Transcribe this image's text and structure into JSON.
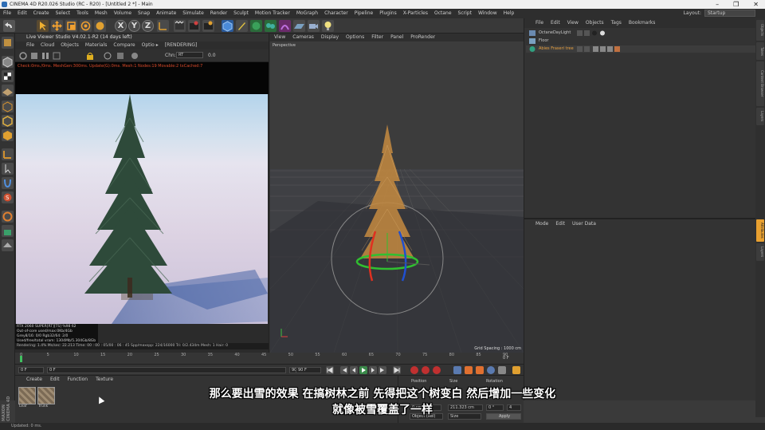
{
  "window": {
    "title": "CINEMA 4D R20.026 Studio (RC - R20) - [Untitled 2 *] - Main",
    "controls": [
      "–",
      "❒",
      "✕"
    ]
  },
  "menubar": {
    "items": [
      "File",
      "Edit",
      "Create",
      "Select",
      "Tools",
      "Mesh",
      "Volume",
      "Snap",
      "Animate",
      "Simulate",
      "Render",
      "Sculpt",
      "Motion Tracker",
      "MoGraph",
      "Character",
      "Pipeline",
      "Plugins",
      "X-Particles",
      "Octane",
      "Script",
      "Window",
      "Help"
    ],
    "layout_label": "Layout:",
    "layout_value": "Startup"
  },
  "toolbar": {
    "axis_x": "X",
    "axis_y": "Y",
    "axis_z": "Z"
  },
  "live_viewer": {
    "title": "Live Viewer Studio V4.02.1-R2 (14 days left)",
    "menu": [
      "File",
      "Cloud",
      "Objects",
      "Materials",
      "Compare",
      "Optio ▸"
    ],
    "rendering_tag": "[RENDERING]",
    "channel_label": "Chn:",
    "channel_value": "RT",
    "exposure": "0.0",
    "log": "Check:0ms./0ms. MeshGen:300ms. Update(G):0ms. Mesh:1 Nodes:19 Movable:2 txCached:7",
    "stats": [
      "RTX 2060 SUPER[RT][TS]   %98    62",
      "Out-of-core used/max:0Kb/4Gb",
      "Grey8/16: 0/0          Rgb32/64: 2/0",
      "Used/free/total vram: 1304Mb/5.304Gb/8Gb"
    ],
    "status": "Rendering: 1.4%   Ms/sec: 22.213   Time: 00 : 00 : 05/00 : 06 : 45   Spp/maxspp: 224/16000   Tri: 0/2.434m   Mesh: 1   Hair: 0"
  },
  "viewport": {
    "menu": [
      "View",
      "Cameras",
      "Display",
      "Options",
      "Filter",
      "Panel",
      "ProRender"
    ],
    "label": "Perspective",
    "grid_spacing": "Grid Spacing : 1000 cm"
  },
  "object_manager": {
    "menu": [
      "File",
      "Edit",
      "View",
      "Objects",
      "Tags",
      "Bookmarks"
    ],
    "objects": [
      {
        "name": "OctaneDayLight",
        "color": "#e0e0e0"
      },
      {
        "name": "Floor",
        "color": "#e0e0e0"
      },
      {
        "name": "Abies Fraseri tree",
        "color": "#e8a040"
      }
    ]
  },
  "attribute_manager": {
    "menu": [
      "Mode",
      "Edit",
      "User Data"
    ]
  },
  "right_tabs": [
    "Objects",
    "Takes",
    "Content Browser",
    "Layers",
    "Attributes",
    "Layers"
  ],
  "timeline": {
    "ticks": [
      "0",
      "5",
      "10",
      "15",
      "20",
      "25",
      "30",
      "35",
      "40",
      "45",
      "50",
      "55",
      "60",
      "65",
      "70",
      "75",
      "80",
      "85",
      "90"
    ],
    "frame_indicator": "0 F",
    "start_field": "0 F",
    "start_field_2": "0 F",
    "end_field": "90 F",
    "end_field_2": "90 F"
  },
  "materials": {
    "menu": [
      "Create",
      "Edit",
      "Function",
      "Texture"
    ],
    "items": [
      {
        "name": "Leaf"
      },
      {
        "name": "Trunk"
      }
    ]
  },
  "coordinates": {
    "headers": [
      "Position",
      "Size",
      "Rotation"
    ],
    "values": [
      "0 cm",
      "211.323 cm",
      "0 °",
      "4"
    ],
    "mode_object": "Object (Rel)",
    "mode_size": "Size",
    "apply": "Apply"
  },
  "brand": "MAXON CINEMA 4D",
  "status_bar": "Updated: 0 ms.",
  "subtitles": {
    "line1": "那么要出雪的效果 在搞树林之前 先得把这个树变白 然后增加一些变化",
    "line2": "就像被雪覆盖了一样"
  }
}
